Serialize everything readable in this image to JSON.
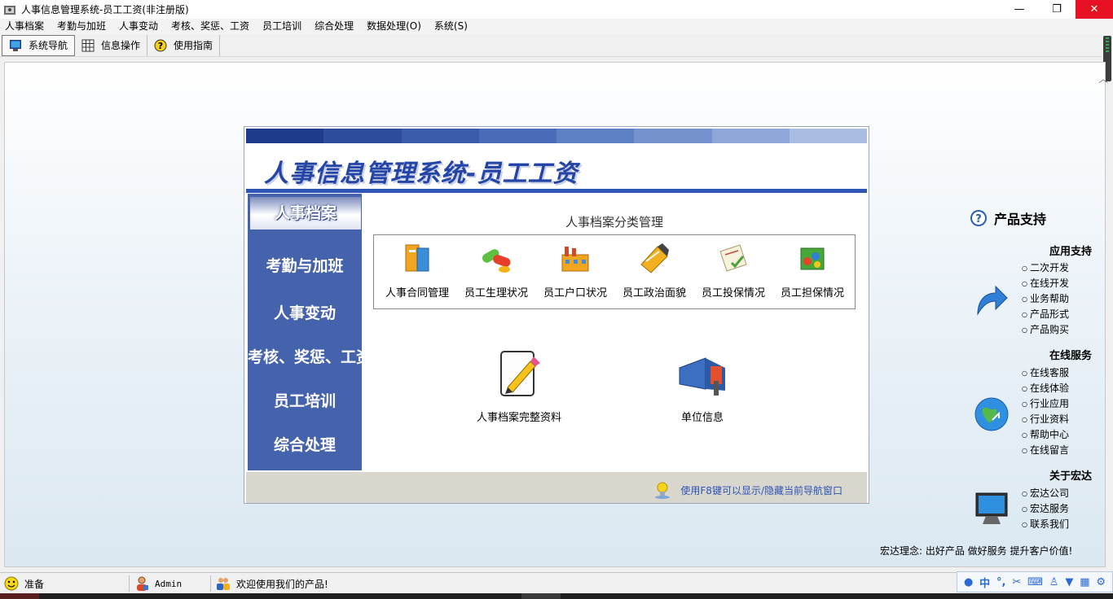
{
  "window": {
    "title": "人事信息管理系统-员工工资(非注册版)",
    "controls": {
      "minimize": "—",
      "maximize": "❐",
      "close": "✕"
    }
  },
  "menu": [
    "人事档案",
    "考勤与加班",
    "人事变动",
    "考核、奖惩、工资",
    "员工培训",
    "综合处理",
    "数据处理(O)",
    "系统(S)"
  ],
  "toolbar": {
    "nav": "系统导航",
    "info": "信息操作",
    "guide": "使用指南"
  },
  "panel": {
    "header": "人事信息管理系统-员工工资",
    "nav_items": [
      "人事档案",
      "考勤与加班",
      "人事变动",
      "考核、奖惩、工资",
      "员工培训",
      "综合处理"
    ],
    "section_title": "人事档案分类管理",
    "categories": [
      "人事合同管理",
      "员工生理状况",
      "员工户口状况",
      "员工政治面貌",
      "员工投保情况",
      "员工担保情况"
    ],
    "big_items": [
      "人事档案完整资料",
      "单位信息"
    ],
    "footer_hint": "使用F8键可以显示/隐藏当前导航窗口"
  },
  "support": {
    "title": "产品支持",
    "groups": [
      {
        "title": "应用支持",
        "items": [
          "二次开发",
          "在线开发",
          "业务帮助",
          "产品形式",
          "产品购买"
        ]
      },
      {
        "title": "在线服务",
        "items": [
          "在线客服",
          "在线体验",
          "行业应用",
          "行业资料",
          "帮助中心",
          "在线留言"
        ]
      },
      {
        "title": "关于宏达",
        "items": [
          "宏达公司",
          "宏达服务",
          "联系我们"
        ]
      }
    ],
    "motto": "宏达理念: 出好产品  做好服务  提升客户价值!"
  },
  "status": {
    "ready": "准备",
    "user": "Admin",
    "welcome": "欢迎使用我们的产品!",
    "ime": "中"
  },
  "colors": {
    "nav_blue": "#4563ad",
    "header_text": "#2445a6",
    "hint_text": "#2a54b6",
    "close_red": "#e81123"
  }
}
